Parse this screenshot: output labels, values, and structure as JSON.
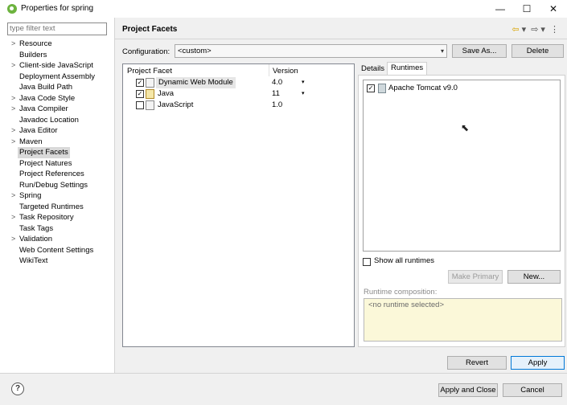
{
  "window": {
    "title": "Properties for spring",
    "minimize": "—",
    "maximize": "☐",
    "close": "✕"
  },
  "filter": {
    "placeholder": "type filter text"
  },
  "tree": [
    {
      "label": "Resource",
      "arrow": ">"
    },
    {
      "label": "Builders",
      "arrow": ""
    },
    {
      "label": "Client-side JavaScript",
      "arrow": ">"
    },
    {
      "label": "Deployment Assembly",
      "arrow": ""
    },
    {
      "label": "Java Build Path",
      "arrow": ""
    },
    {
      "label": "Java Code Style",
      "arrow": ">"
    },
    {
      "label": "Java Compiler",
      "arrow": ">"
    },
    {
      "label": "Javadoc Location",
      "arrow": ""
    },
    {
      "label": "Java Editor",
      "arrow": ">"
    },
    {
      "label": "Maven",
      "arrow": ">"
    },
    {
      "label": "Project Facets",
      "arrow": "",
      "selected": true
    },
    {
      "label": "Project Natures",
      "arrow": ""
    },
    {
      "label": "Project References",
      "arrow": ""
    },
    {
      "label": "Run/Debug Settings",
      "arrow": ""
    },
    {
      "label": "Spring",
      "arrow": ">"
    },
    {
      "label": "Targeted Runtimes",
      "arrow": ""
    },
    {
      "label": "Task Repository",
      "arrow": ">"
    },
    {
      "label": "Task Tags",
      "arrow": ""
    },
    {
      "label": "Validation",
      "arrow": ">"
    },
    {
      "label": "Web Content Settings",
      "arrow": ""
    },
    {
      "label": "WikiText",
      "arrow": ""
    }
  ],
  "page": {
    "heading": "Project Facets",
    "nav_icons": {
      "back": "⇦",
      "back_menu": "▾",
      "forward": "⇨",
      "forward_menu": "▾",
      "menu": "⋮"
    }
  },
  "configuration": {
    "label": "Configuration:",
    "value": "<custom>",
    "caret": "▾",
    "save_as": "Save As...",
    "delete": "Delete"
  },
  "facets": {
    "col_facet": "Project Facet",
    "col_version": "Version",
    "rows": [
      {
        "name": "Dynamic Web Module",
        "version": "4.0",
        "checked": "✓",
        "caret": "▾"
      },
      {
        "name": "Java",
        "version": "11",
        "checked": "✓",
        "caret": "▾"
      },
      {
        "name": "JavaScript",
        "version": "1.0",
        "checked": "",
        "caret": ""
      }
    ]
  },
  "tabs": {
    "details": "Details",
    "runtimes": "Runtimes"
  },
  "runtimes": {
    "items": [
      {
        "name": "Apache Tomcat v9.0",
        "checked": "✓"
      }
    ],
    "show_all": "Show all runtimes",
    "make_primary": "Make Primary",
    "new": "New...",
    "composition_label": "Runtime composition:",
    "composition_value": "<no runtime selected>"
  },
  "buttons": {
    "revert": "Revert",
    "apply": "Apply",
    "apply_close": "Apply and Close",
    "cancel": "Cancel"
  },
  "help": "?"
}
